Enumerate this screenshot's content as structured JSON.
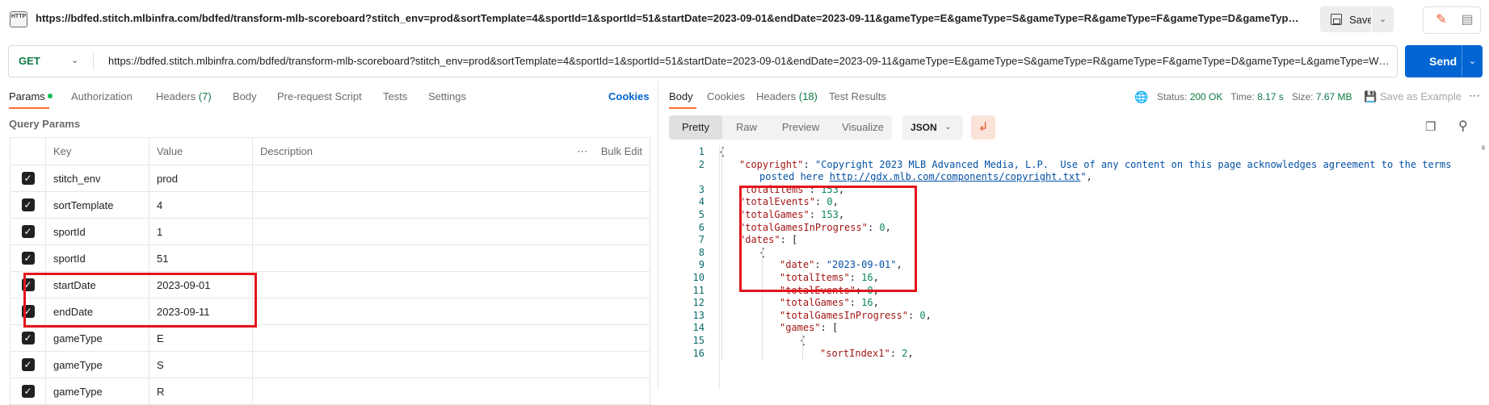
{
  "window": {
    "http_icon_text": "HTTP",
    "title_url": "https://bdfed.stitch.mlbinfra.com/bdfed/transform-mlb-scoreboard?stitch_env=prod&sortTemplate=4&sportId=1&sportId=51&startDate=2023-09-01&endDate=2023-09-11&gameType=E&gameType=S&gameType=R&gameType=F&gameType=D&gameType=L&gameT...",
    "save_label": "Save"
  },
  "request": {
    "method": "GET",
    "url": "https://bdfed.stitch.mlbinfra.com/bdfed/transform-mlb-scoreboard?stitch_env=prod&sortTemplate=4&sportId=1&sportId=51&startDate=2023-09-01&endDate=2023-09-11&gameType=E&gameType=S&gameType=R&gameType=F&gameType=D&gameType=L&gameType=W&gam...",
    "send_label": "Send"
  },
  "request_tabs": [
    {
      "label": "Params"
    },
    {
      "label": "Authorization"
    },
    {
      "label": "Headers",
      "count": "(7)"
    },
    {
      "label": "Body"
    },
    {
      "label": "Pre-request Script"
    },
    {
      "label": "Tests"
    },
    {
      "label": "Settings"
    }
  ],
  "cookies_link": "Cookies",
  "query_params_label": "Query Params",
  "params_table": {
    "headers": {
      "key": "Key",
      "value": "Value",
      "description": "Description",
      "bulk_edit": "Bulk Edit"
    },
    "rows": [
      {
        "key": "stitch_env",
        "value": "prod",
        "checked": true
      },
      {
        "key": "sortTemplate",
        "value": "4",
        "checked": true
      },
      {
        "key": "sportId",
        "value": "1",
        "checked": true
      },
      {
        "key": "sportId",
        "value": "51",
        "checked": true
      },
      {
        "key": "startDate",
        "value": "2023-09-01",
        "checked": true
      },
      {
        "key": "endDate",
        "value": "2023-09-11",
        "checked": true
      },
      {
        "key": "gameType",
        "value": "E",
        "checked": true
      },
      {
        "key": "gameType",
        "value": "S",
        "checked": true
      },
      {
        "key": "gameType",
        "value": "R",
        "checked": true
      }
    ]
  },
  "response_tabs": [
    {
      "label": "Body"
    },
    {
      "label": "Cookies"
    },
    {
      "label": "Headers",
      "count": "(18)"
    },
    {
      "label": "Test Results"
    }
  ],
  "response_status": {
    "status_label": "Status:",
    "status_value": "200 OK",
    "time_label": "Time:",
    "time_value": "8.17 s",
    "size_label": "Size:",
    "size_value": "7.67 MB",
    "save_example": "Save as Example"
  },
  "view_modes": [
    "Pretty",
    "Raw",
    "Preview",
    "Visualize"
  ],
  "format": "JSON",
  "code_lines": [
    {
      "n": "1",
      "indent": 0,
      "parts": [
        [
          "p",
          "{"
        ]
      ]
    },
    {
      "n": "2",
      "indent": 1,
      "parts": [
        [
          "k",
          "\"copyright\""
        ],
        [
          "p",
          ": "
        ],
        [
          "s",
          "\"Copyright 2023 MLB Advanced Media, L.P.  Use of any content on this page acknowledges agreement to the terms"
        ]
      ]
    },
    {
      "n": "",
      "indent": 2,
      "parts": [
        [
          "s",
          "posted here "
        ],
        [
          "u",
          "http://gdx.mlb.com/components/copyright.txt"
        ],
        [
          "s",
          "\""
        ],
        [
          "p",
          ","
        ]
      ]
    },
    {
      "n": "3",
      "indent": 1,
      "parts": [
        [
          "k",
          "\"totalItems\""
        ],
        [
          "p",
          ": "
        ],
        [
          "n",
          "153"
        ],
        [
          "p",
          ","
        ]
      ]
    },
    {
      "n": "4",
      "indent": 1,
      "parts": [
        [
          "k",
          "\"totalEvents\""
        ],
        [
          "p",
          ": "
        ],
        [
          "n",
          "0"
        ],
        [
          "p",
          ","
        ]
      ]
    },
    {
      "n": "5",
      "indent": 1,
      "parts": [
        [
          "k",
          "\"totalGames\""
        ],
        [
          "p",
          ": "
        ],
        [
          "n",
          "153"
        ],
        [
          "p",
          ","
        ]
      ]
    },
    {
      "n": "6",
      "indent": 1,
      "parts": [
        [
          "k",
          "\"totalGamesInProgress\""
        ],
        [
          "p",
          ": "
        ],
        [
          "n",
          "0"
        ],
        [
          "p",
          ","
        ]
      ]
    },
    {
      "n": "7",
      "indent": 1,
      "parts": [
        [
          "k",
          "\"dates\""
        ],
        [
          "p",
          ": ["
        ]
      ]
    },
    {
      "n": "8",
      "indent": 2,
      "parts": [
        [
          "p",
          "{"
        ]
      ]
    },
    {
      "n": "9",
      "indent": 3,
      "parts": [
        [
          "k",
          "\"date\""
        ],
        [
          "p",
          ": "
        ],
        [
          "s",
          "\"2023-09-01\""
        ],
        [
          "p",
          ","
        ]
      ]
    },
    {
      "n": "10",
      "indent": 3,
      "parts": [
        [
          "k",
          "\"totalItems\""
        ],
        [
          "p",
          ": "
        ],
        [
          "n",
          "16"
        ],
        [
          "p",
          ","
        ]
      ]
    },
    {
      "n": "11",
      "indent": 3,
      "parts": [
        [
          "k",
          "\"totalEvents\""
        ],
        [
          "p",
          ": "
        ],
        [
          "n",
          "0"
        ],
        [
          "p",
          ","
        ]
      ]
    },
    {
      "n": "12",
      "indent": 3,
      "parts": [
        [
          "k",
          "\"totalGames\""
        ],
        [
          "p",
          ": "
        ],
        [
          "n",
          "16"
        ],
        [
          "p",
          ","
        ]
      ]
    },
    {
      "n": "13",
      "indent": 3,
      "parts": [
        [
          "k",
          "\"totalGamesInProgress\""
        ],
        [
          "p",
          ": "
        ],
        [
          "n",
          "0"
        ],
        [
          "p",
          ","
        ]
      ]
    },
    {
      "n": "14",
      "indent": 3,
      "parts": [
        [
          "k",
          "\"games\""
        ],
        [
          "p",
          ": ["
        ]
      ]
    },
    {
      "n": "15",
      "indent": 4,
      "parts": [
        [
          "p",
          "{"
        ]
      ]
    },
    {
      "n": "16",
      "indent": 5,
      "parts": [
        [
          "k",
          "\"sortIndex1\""
        ],
        [
          "p",
          ": "
        ],
        [
          "n",
          "2"
        ],
        [
          "p",
          ","
        ]
      ]
    }
  ],
  "colors": {
    "accent": "#ff6c37",
    "send": "#0265d2",
    "highlight": "#e3141b",
    "status_ok": "#0c7a43"
  },
  "icons": [
    "http-icon",
    "save-icon",
    "chevron-down-icon",
    "edit-icon",
    "documentation-icon",
    "globe-icon",
    "more-icon",
    "wrap-icon",
    "copy-icon",
    "search-icon",
    "checkbox-icon"
  ]
}
